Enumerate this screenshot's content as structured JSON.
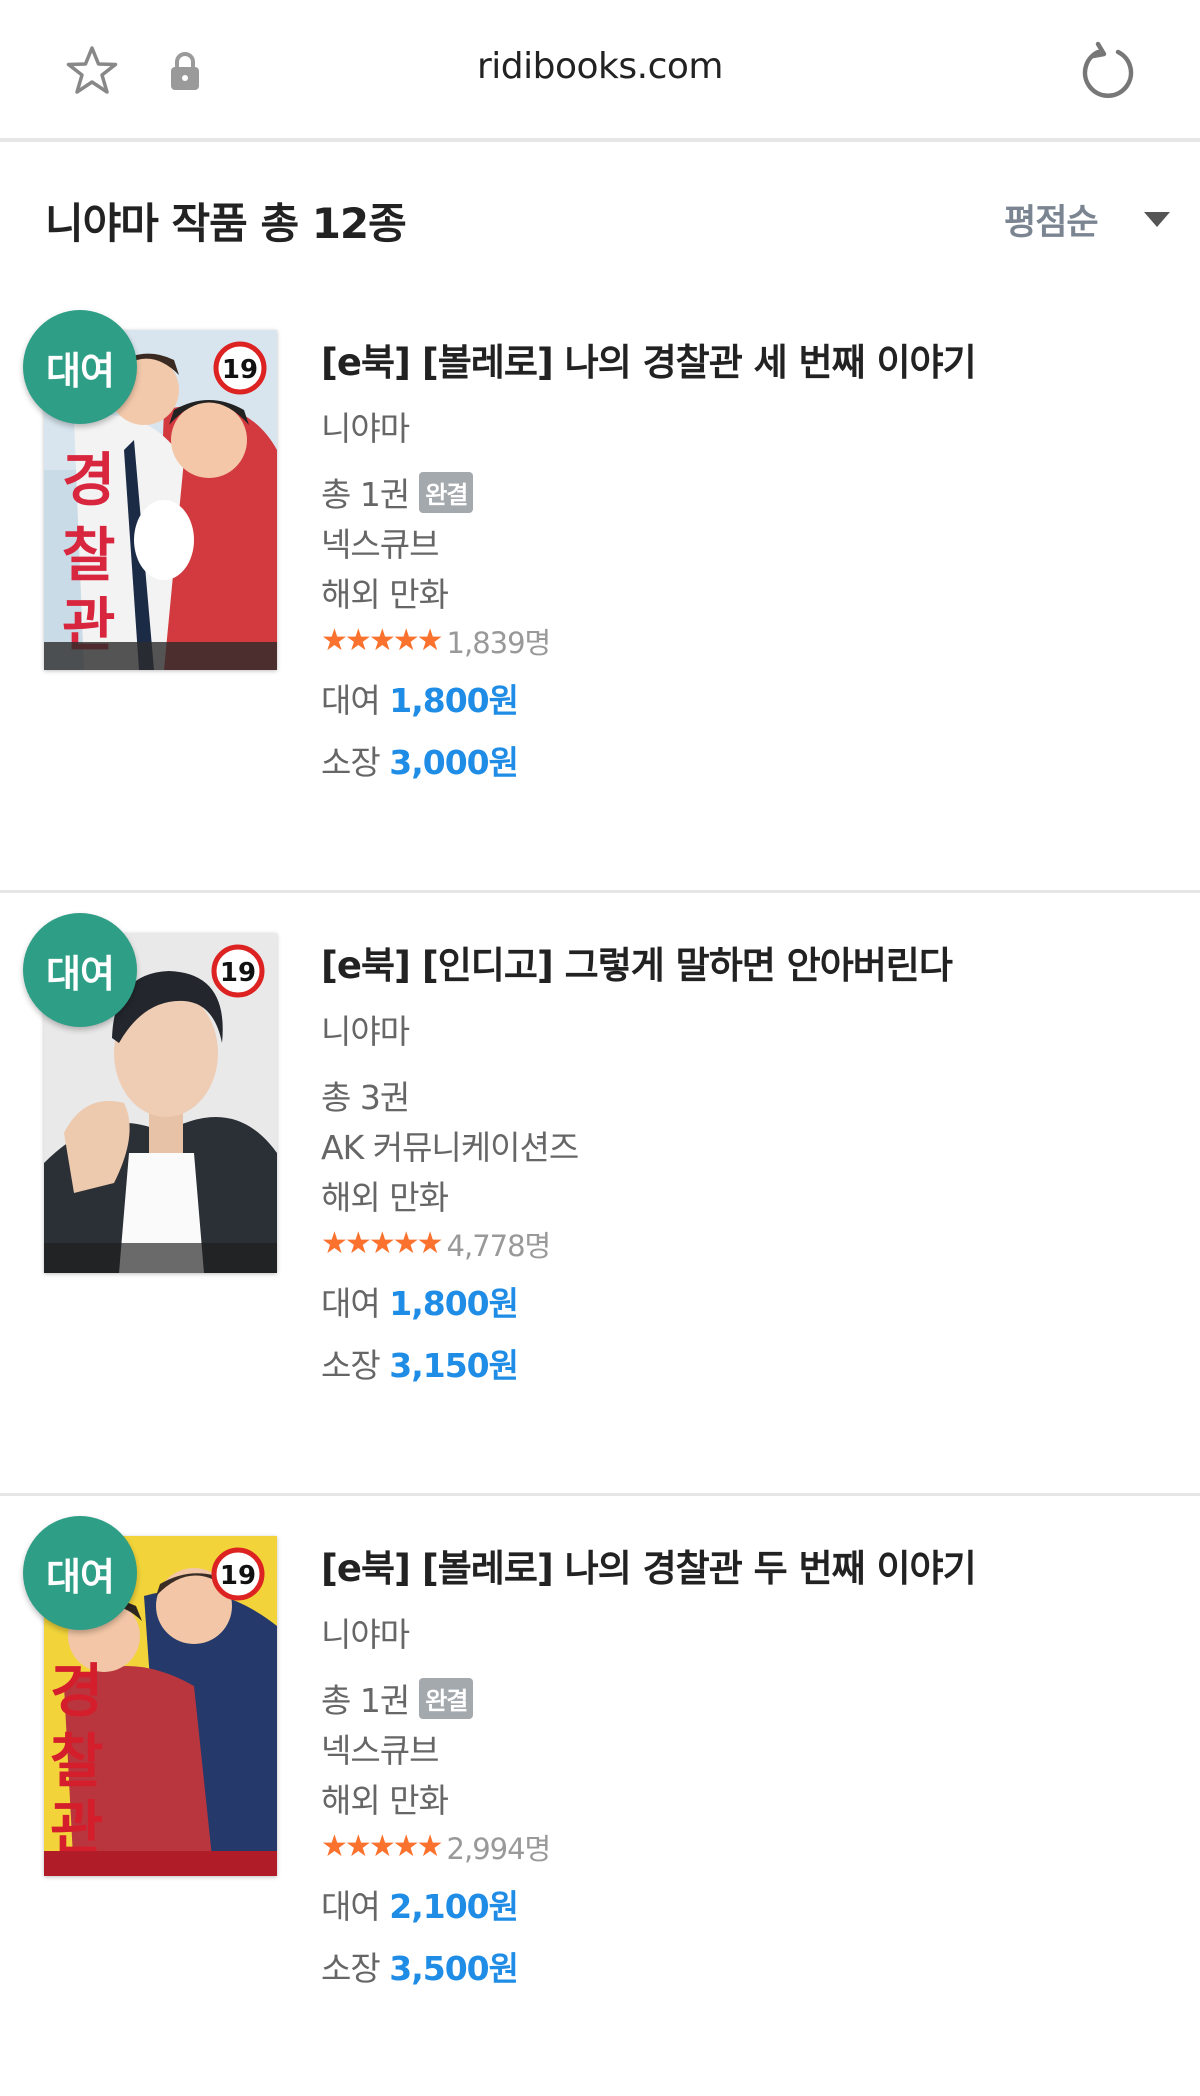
{
  "browser": {
    "url": "ridibooks.com",
    "icons": {
      "bookmark": "star-icon",
      "lock": "lock-icon",
      "reload": "reload-icon"
    }
  },
  "page": {
    "title": "니야마 작품 총 12종",
    "sort_label": "평점순"
  },
  "colors": {
    "rent_badge": "#2e9f86",
    "price": "#1f8ce6",
    "star": "#fa722e",
    "complete_tag": "#a4a9ae"
  },
  "books": [
    {
      "badge": "대여",
      "age_mark": "19",
      "title": "[e북] [볼레로] 나의 경찰관 세 번째 이야기",
      "author": "니야마",
      "volumes": "총 1권",
      "complete_tag": "완결",
      "publisher": "넥스큐브",
      "category": "해외 만화",
      "rating_stars": 5,
      "rating_count": "1,839명",
      "rent_label": "대여",
      "rent_price": "1,800원",
      "buy_label": "소장",
      "buy_price": "3,000원"
    },
    {
      "badge": "대여",
      "age_mark": "19",
      "title": "[e북] [인디고] 그렇게 말하면 안아버린다",
      "author": "니야마",
      "volumes": "총 3권",
      "complete_tag": "",
      "publisher": "AK 커뮤니케이션즈",
      "category": "해외 만화",
      "rating_stars": 5,
      "rating_count": "4,778명",
      "rent_label": "대여",
      "rent_price": "1,800원",
      "buy_label": "소장",
      "buy_price": "3,150원"
    },
    {
      "badge": "대여",
      "age_mark": "19",
      "title": "[e북] [볼레로] 나의 경찰관 두 번째 이야기",
      "author": "니야마",
      "volumes": "총 1권",
      "complete_tag": "완결",
      "publisher": "넥스큐브",
      "category": "해외 만화",
      "rating_stars": 5,
      "rating_count": "2,994명",
      "rent_label": "대여",
      "rent_price": "2,100원",
      "buy_label": "소장",
      "buy_price": "3,500원"
    }
  ]
}
